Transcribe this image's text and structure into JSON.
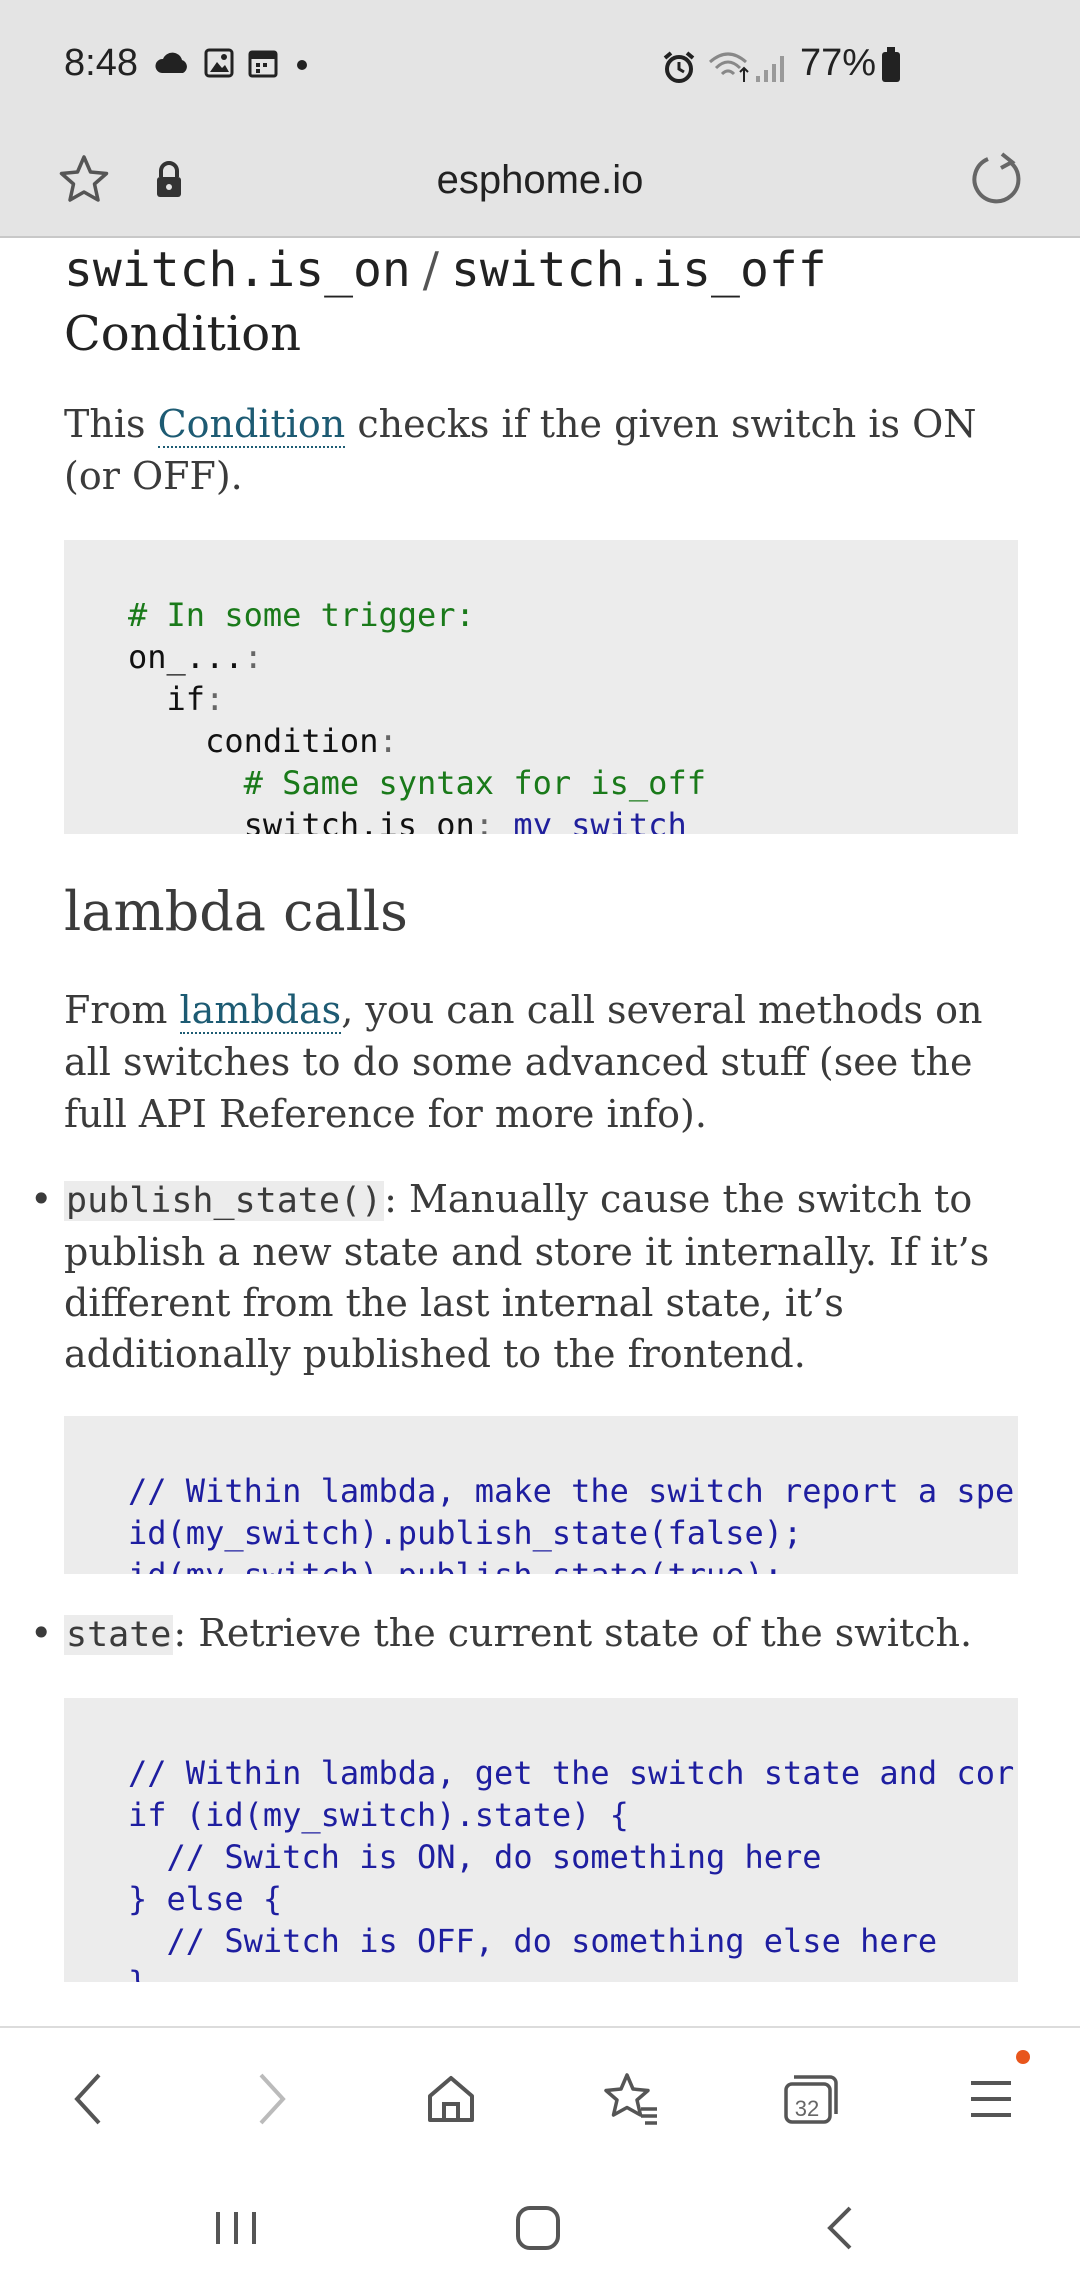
{
  "status_bar": {
    "time": "8:48",
    "battery": "77%",
    "icons_left": [
      "cloud-icon",
      "image-icon",
      "calendar-icon",
      "dot-icon"
    ],
    "icons_right": [
      "alarm-icon",
      "wifi-icon",
      "signal-icon",
      "battery-icon"
    ]
  },
  "browser": {
    "url": "esphome.io",
    "tabs_count": "32"
  },
  "section_condition": {
    "code_title_on": "switch.is_on",
    "separator": "/",
    "code_title_off": "switch.is_off",
    "title_suffix": "Condition",
    "para_prefix": "This ",
    "para_link": "Condition",
    "para_suffix": " checks if the given switch is ON (or OFF).",
    "code": {
      "l1": "# In some trigger:",
      "l2_key": "on_...",
      "l2_colon": ":",
      "l3_key": "if",
      "l3_colon": ":",
      "l4_key": "condition",
      "l4_colon": ":",
      "l5": "# Same syntax for is_off",
      "l6_key": "switch.is_on",
      "l6_colon": ":",
      "l6_val": "my_switch"
    }
  },
  "section_lambda": {
    "title": "lambda calls",
    "para_prefix": "From ",
    "para_link": "lambdas",
    "para_suffix": ", you can call several methods on all switches to do some advanced stuff (see the full API Reference for more info).",
    "bullet1_code": "publish_state()",
    "bullet1_text": ": Manually cause the switch to publish a new state and store it internally. If it’s different from the last internal state, it’s additionally published to the frontend.",
    "code1": {
      "l1": "// Within lambda, make the switch report a spe",
      "l2": "id(my_switch).publish_state(false);",
      "l3": "id(my_switch).publish_state(true);"
    },
    "bullet2_code": "state",
    "bullet2_text": ": Retrieve the current state of the switch.",
    "code2": {
      "l1": "// Within lambda, get the switch state and cor",
      "l2": "if (id(my_switch).state) {",
      "l3": "  // Switch is ON, do something here",
      "l4": "} else {",
      "l5": "  // Switch is OFF, do something else here",
      "l6": "}"
    }
  }
}
